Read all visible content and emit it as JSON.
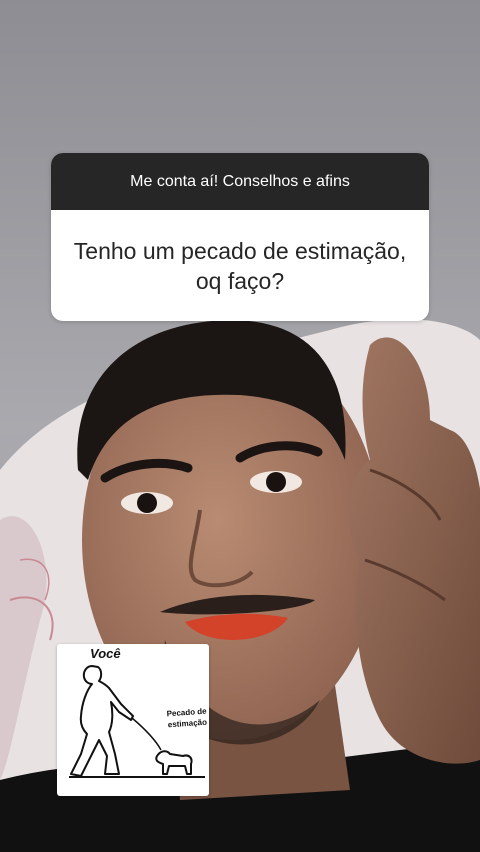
{
  "question_sticker": {
    "header": "Me conta aí! Conselhos e afins",
    "question": "Tenho um pecado de estimação, oq faço?"
  },
  "image_sticker": {
    "label_you": "Você",
    "label_pet": "Pecado de estimação"
  },
  "colors": {
    "card_header_bg": "#262626",
    "card_body_bg": "#ffffff",
    "background_wall": "#9a9aa0"
  }
}
